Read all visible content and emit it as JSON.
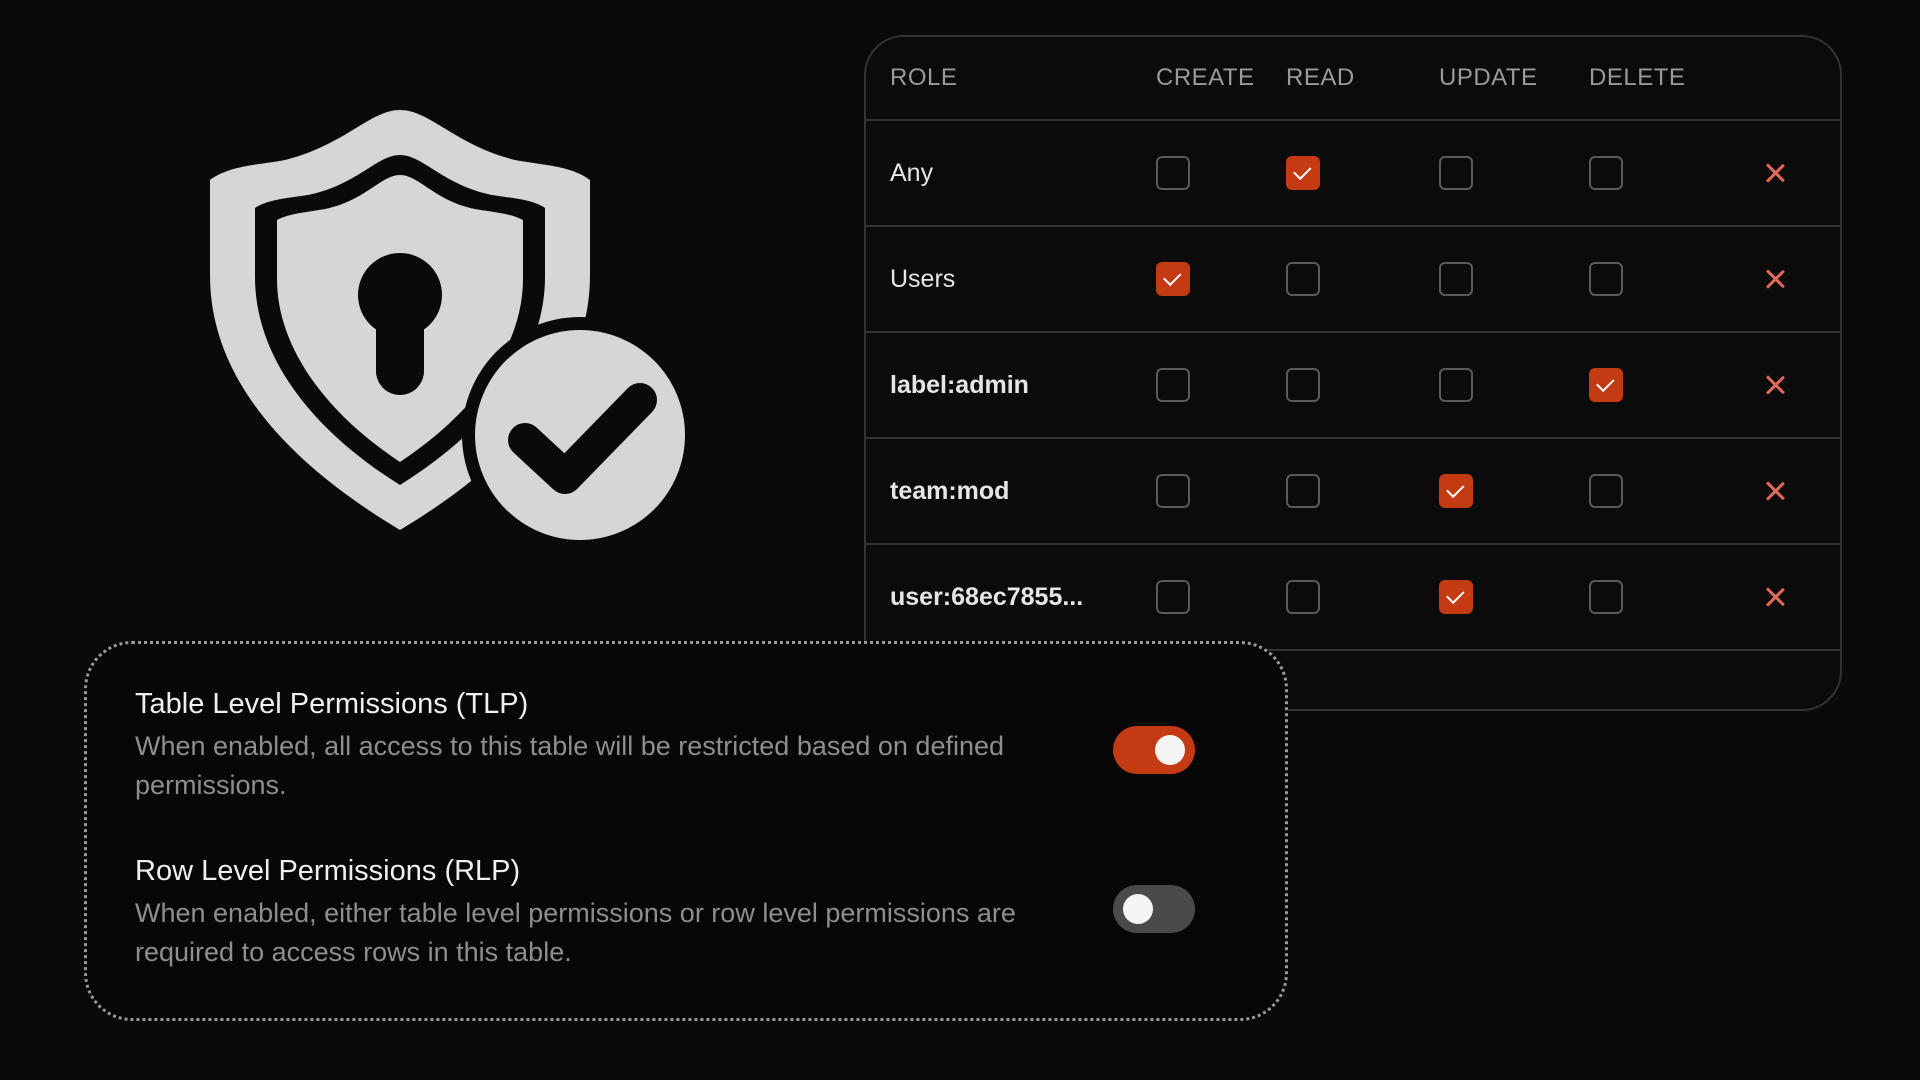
{
  "permissions": {
    "headers": {
      "role": "ROLE",
      "create": "CREATE",
      "read": "READ",
      "update": "UPDATE",
      "delete": "DELETE"
    },
    "rows": [
      {
        "role": "Any",
        "create": false,
        "read": true,
        "update": false,
        "delete": false
      },
      {
        "role": "Users",
        "create": true,
        "read": false,
        "update": false,
        "delete": false
      },
      {
        "role": "label:admin",
        "create": false,
        "read": false,
        "update": false,
        "delete": true
      },
      {
        "role": "team:mod",
        "create": false,
        "read": false,
        "update": true,
        "delete": false
      },
      {
        "role": "user:68ec7855...",
        "create": false,
        "read": false,
        "update": true,
        "delete": false
      }
    ],
    "remove_icon": "close-icon"
  },
  "settings": {
    "tlp": {
      "title": "Table Level Permissions (TLP)",
      "description": "When enabled, all access to this table will be restricted based on defined permissions.",
      "enabled": true
    },
    "rlp": {
      "title": "Row Level Permissions (RLP)",
      "description": "When enabled, either table level permissions or row level permissions are required to access rows in this table.",
      "enabled": false
    }
  },
  "illustration": {
    "icon": "shield-lock-check-icon"
  },
  "colors": {
    "accent": "#c33a13",
    "remove": "#e06a5a",
    "background": "#0a0a0a",
    "border": "#333333",
    "shield": "#d6d6d6"
  }
}
